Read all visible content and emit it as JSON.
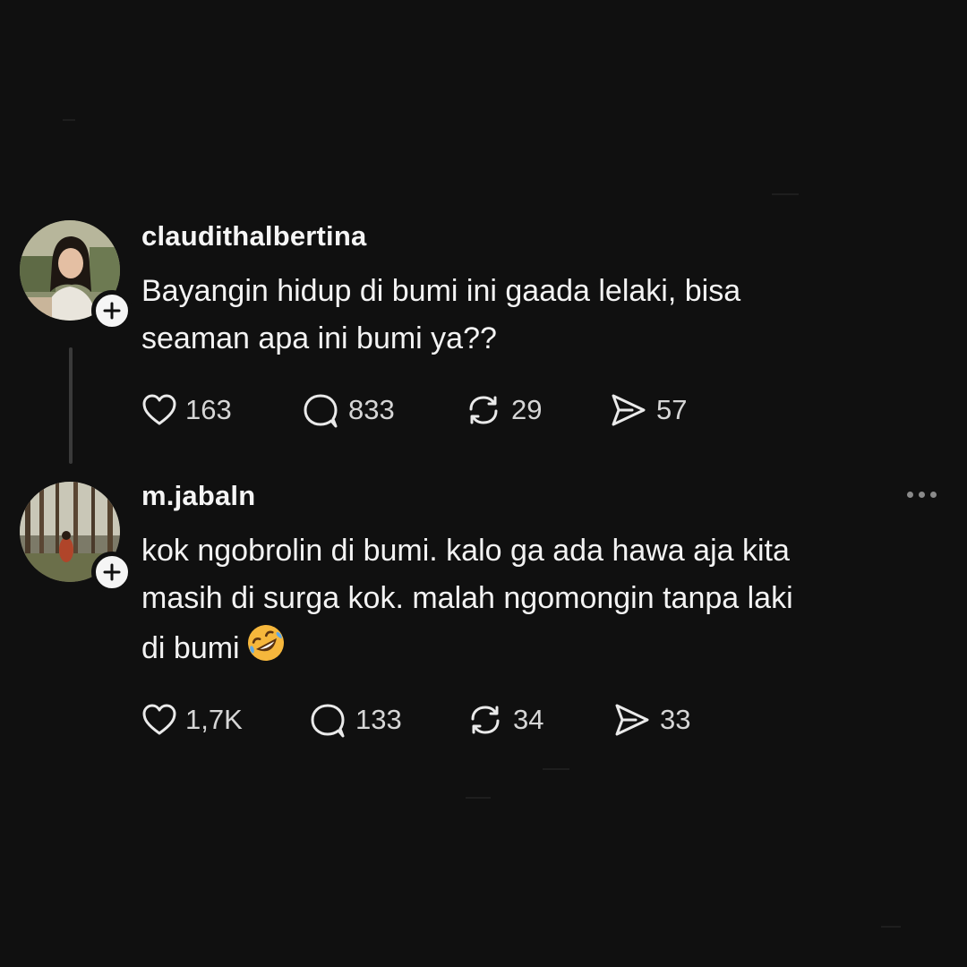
{
  "posts": [
    {
      "username": "claudithalbertina",
      "text": "Bayangin hidup di bumi ini gaada lelaki, bisa\nseaman apa ini bumi ya??",
      "emoji": "",
      "avatar_icon": "profile-photo-woman",
      "follow_icon": "plus-icon",
      "stats": {
        "likes": "163",
        "replies": "833",
        "reposts": "29",
        "shares": "57"
      }
    },
    {
      "username": "m.jabaln",
      "text": "kok ngobrolin di bumi. kalo ga ada hawa aja kita\nmasih di surga kok. malah ngomongin tanpa laki\ndi bumi",
      "emoji": "rolling-on-floor-laughing",
      "avatar_icon": "profile-photo-forest",
      "follow_icon": "plus-icon",
      "more_icon": "more-options-icon",
      "stats": {
        "likes": "1,7K",
        "replies": "133",
        "reposts": "34",
        "shares": "33"
      }
    }
  ],
  "colors": {
    "background": "#101010",
    "text": "#f3f3f3",
    "muted": "#d6d6d6",
    "thread_line": "#3a3a3a"
  }
}
